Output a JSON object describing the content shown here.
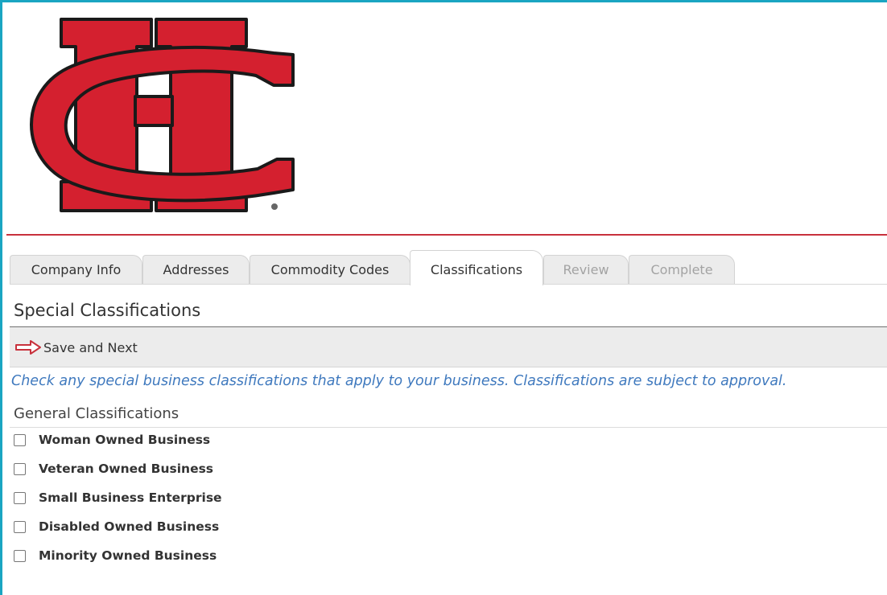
{
  "logo": {
    "name": "company-logo",
    "colors": {
      "red": "#d4202f",
      "outline": "#1a1a1a"
    }
  },
  "tabs": [
    {
      "label": "Company Info",
      "state": "normal"
    },
    {
      "label": "Addresses",
      "state": "normal"
    },
    {
      "label": "Commodity Codes",
      "state": "normal"
    },
    {
      "label": "Classifications",
      "state": "active"
    },
    {
      "label": "Review",
      "state": "disabled"
    },
    {
      "label": "Complete",
      "state": "disabled"
    }
  ],
  "section": {
    "title": "Special Classifications"
  },
  "toolbar": {
    "save_next_label": "Save and Next",
    "save_icon": "arrow-right-outline-icon",
    "icon_color": "#c8313c"
  },
  "instructions": "Check any special business classifications that apply to your business. Classifications are subject to approval.",
  "group": {
    "title": "General Classifications",
    "items": [
      {
        "label": "Woman Owned Business",
        "checked": false
      },
      {
        "label": "Veteran Owned Business",
        "checked": false
      },
      {
        "label": "Small Business Enterprise",
        "checked": false
      },
      {
        "label": "Disabled Owned Business",
        "checked": false
      },
      {
        "label": "Minority Owned Business",
        "checked": false
      }
    ]
  },
  "colors": {
    "accent_border": "#1aa5c2",
    "divider_red": "#c8313c",
    "link_blue": "#3f79be"
  }
}
